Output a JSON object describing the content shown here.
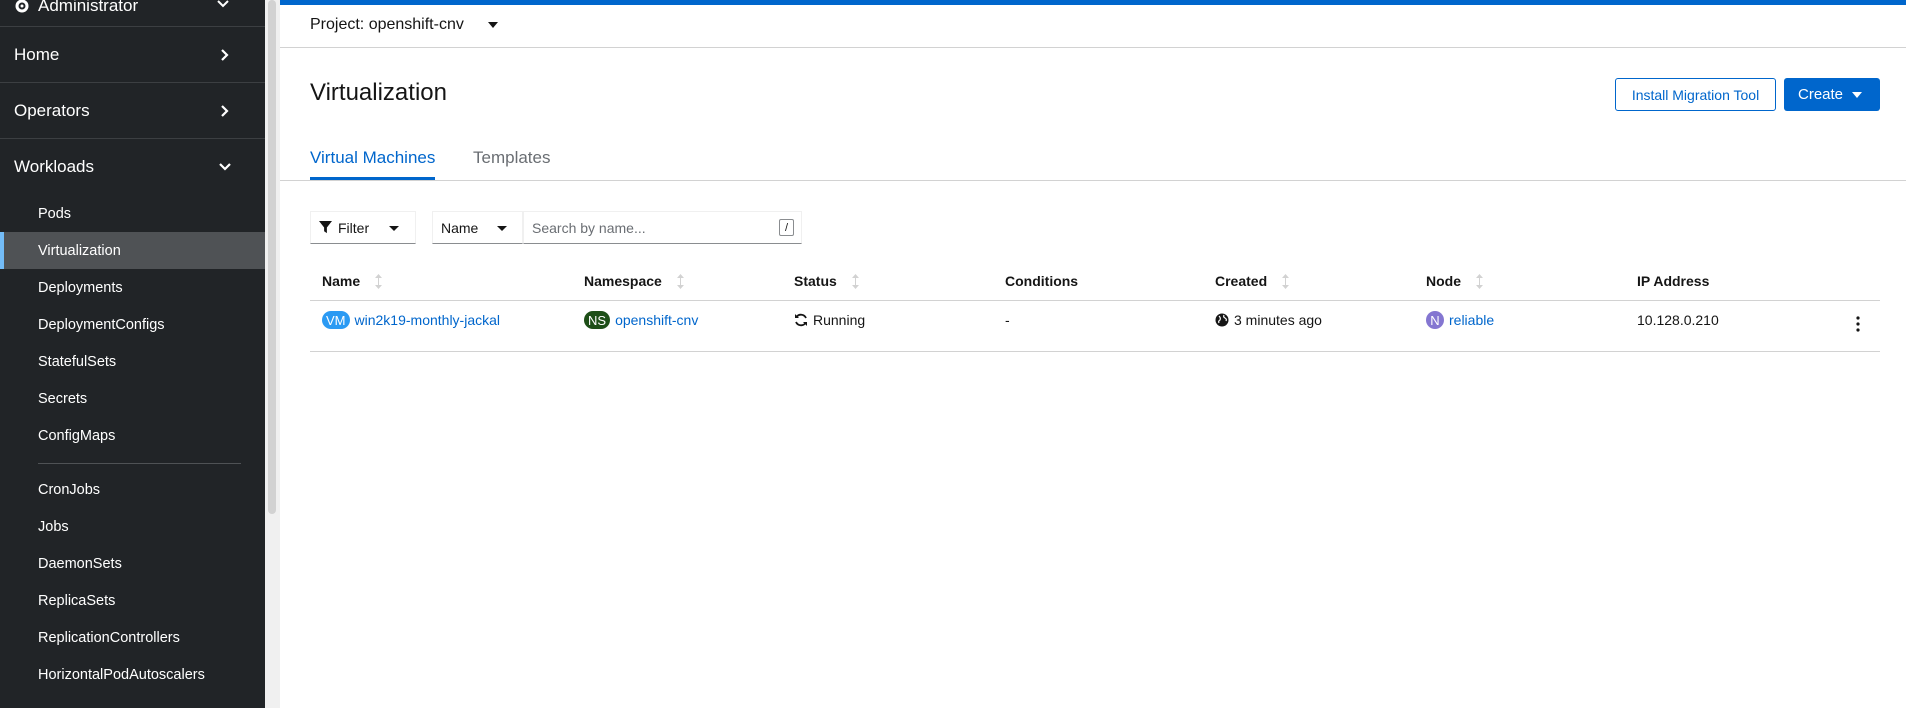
{
  "sidebar": {
    "perspective": "Administrator",
    "sections": [
      {
        "label": "Home"
      },
      {
        "label": "Operators"
      },
      {
        "label": "Workloads"
      }
    ],
    "workloads_items": [
      {
        "label": "Pods"
      },
      {
        "label": "Virtualization"
      },
      {
        "label": "Deployments"
      },
      {
        "label": "DeploymentConfigs"
      },
      {
        "label": "StatefulSets"
      },
      {
        "label": "Secrets"
      },
      {
        "label": "ConfigMaps"
      },
      {
        "label": "CronJobs"
      },
      {
        "label": "Jobs"
      },
      {
        "label": "DaemonSets"
      },
      {
        "label": "ReplicaSets"
      },
      {
        "label": "ReplicationControllers"
      },
      {
        "label": "HorizontalPodAutoscalers"
      }
    ],
    "active_item": "Virtualization"
  },
  "project": {
    "label": "Project: openshift-cnv"
  },
  "page": {
    "title": "Virtualization",
    "install_button": "Install Migration Tool",
    "create_button": "Create"
  },
  "tabs": [
    {
      "label": "Virtual Machines",
      "active": true
    },
    {
      "label": "Templates",
      "active": false
    }
  ],
  "filters": {
    "filter_label": "Filter",
    "name_select": "Name",
    "search_placeholder": "Search by name...",
    "shortcut": "/"
  },
  "table": {
    "headers": [
      "Name",
      "Namespace",
      "Status",
      "Conditions",
      "Created",
      "Node",
      "IP Address"
    ],
    "rows": [
      {
        "name_badge": "VM",
        "name": "win2k19-monthly-jackal",
        "namespace_badge": "NS",
        "namespace": "openshift-cnv",
        "status": "Running",
        "conditions": "-",
        "created": "3 minutes ago",
        "node_badge": "N",
        "node": "reliable",
        "ip": "10.128.0.210"
      }
    ]
  },
  "colors": {
    "accent": "#0066cc",
    "sidebar_bg": "#212427",
    "active_item_bg": "#4f5255",
    "vm_badge": "#2b9af3",
    "ns_badge": "#1e4f18",
    "node_badge": "#8476d1"
  },
  "icons": {
    "perspective": "cog-icon",
    "filter": "funnel-icon",
    "status": "sync-icon",
    "created": "globe-icon",
    "row_actions": "kebab-icon"
  }
}
